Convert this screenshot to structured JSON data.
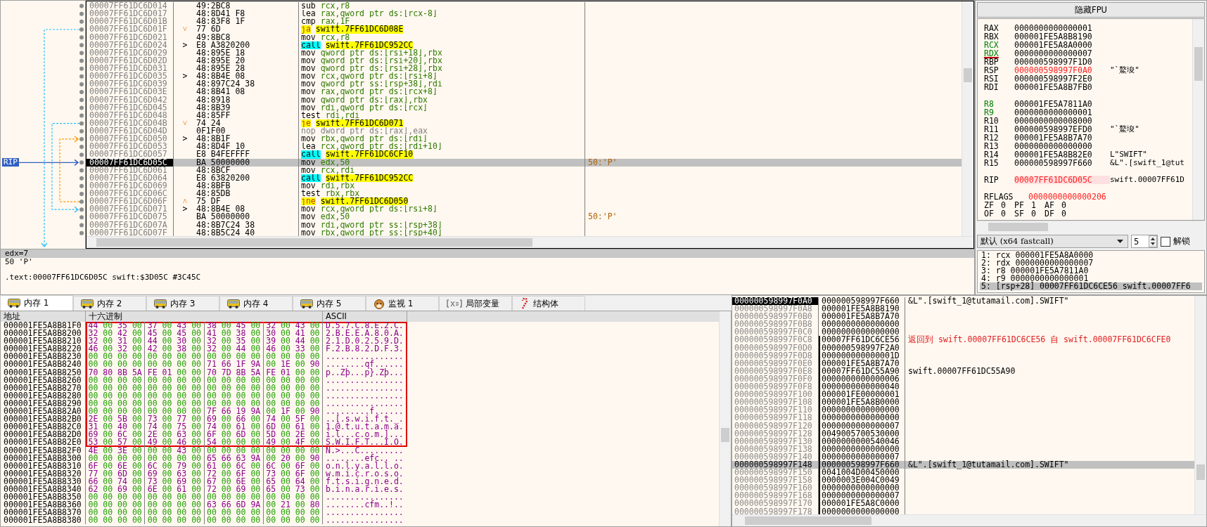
{
  "disassembly": {
    "rip_label": "RIP",
    "rows": [
      {
        "address": "00007FF61DC6D014",
        "bytes": "49:2BC8",
        "mnemonic": "sub",
        "operands": "rcx,r8",
        "kind": "plain",
        "selected": false
      },
      {
        "address": "00007FF61DC6D017",
        "bytes": "48:8D41 F8",
        "mnemonic": "lea",
        "operands": "rax,qword ptr ds:[rcx-8]",
        "kind": "plain",
        "selected": false
      },
      {
        "address": "00007FF61DC6D01B",
        "bytes": "48:83F8 1F",
        "mnemonic": "cmp",
        "operands": "rax,1F",
        "kind": "plain",
        "selected": false
      },
      {
        "address": "00007FF61DC6D01F",
        "marker": {
          "text": "˅",
          "kind": "jump"
        },
        "bytes": "77 6D",
        "mnemonic": "ja",
        "operands": "swift.7FF61DC6D08E",
        "kind": "jump",
        "selected": false
      },
      {
        "address": "00007FF61DC6D021",
        "bytes": "49:8BC8",
        "mnemonic": "mov",
        "operands": "rcx,r8",
        "kind": "plain",
        "selected": false
      },
      {
        "address": "00007FF61DC6D024",
        "marker": {
          "text": ">",
          "kind": "target"
        },
        "bytes": "E8 A3820200",
        "mnemonic": "call",
        "operands": "swift.7FF61DC952CC",
        "kind": "call",
        "selected": false
      },
      {
        "address": "00007FF61DC6D029",
        "bytes": "48:895E 18",
        "mnemonic": "mov",
        "operands": "qword ptr ds:[rsi+18],rbx",
        "kind": "plain",
        "selected": false
      },
      {
        "address": "00007FF61DC6D02D",
        "bytes": "48:895E 20",
        "mnemonic": "mov",
        "operands": "qword ptr ds:[rsi+20],rbx",
        "kind": "plain",
        "selected": false
      },
      {
        "address": "00007FF61DC6D031",
        "bytes": "48:895E 28",
        "mnemonic": "mov",
        "operands": "qword ptr ds:[rsi+28],rbx",
        "kind": "plain",
        "selected": false
      },
      {
        "address": "00007FF61DC6D035",
        "marker": {
          "text": ">",
          "kind": "target"
        },
        "bytes": "48:8B4E 08",
        "mnemonic": "mov",
        "operands": "rcx,qword ptr ds:[rsi+8]",
        "kind": "plain",
        "selected": false
      },
      {
        "address": "00007FF61DC6D039",
        "bytes": "48:897C24 38",
        "mnemonic": "mov",
        "operands": "qword ptr ss:[rsp+38],rdi",
        "kind": "plain",
        "selected": false
      },
      {
        "address": "00007FF61DC6D03E",
        "bytes": "48:8B41 08",
        "mnemonic": "mov",
        "operands": "rax,qword ptr ds:[rcx+8]",
        "kind": "plain",
        "selected": false
      },
      {
        "address": "00007FF61DC6D042",
        "bytes": "48:8918",
        "mnemonic": "mov",
        "operands": "qword ptr ds:[rax],rbx",
        "kind": "plain",
        "selected": false
      },
      {
        "address": "00007FF61DC6D045",
        "bytes": "48:8B39",
        "mnemonic": "mov",
        "operands": "rdi,qword ptr ds:[rcx]",
        "kind": "plain",
        "selected": false
      },
      {
        "address": "00007FF61DC6D048",
        "bytes": "48:85FF",
        "mnemonic": "test",
        "operands": "rdi,rdi",
        "kind": "plain",
        "selected": false
      },
      {
        "address": "00007FF61DC6D04B",
        "marker": {
          "text": "˅",
          "kind": "jump"
        },
        "bytes": "74 24",
        "mnemonic": "je",
        "operands": "swift.7FF61DC6D071",
        "kind": "jump",
        "selected": false
      },
      {
        "address": "00007FF61DC6D04D",
        "bytes": "0F1F00",
        "mnemonic": "nop",
        "operands": "dword ptr ds:[rax],eax",
        "kind": "nop",
        "selected": false
      },
      {
        "address": "00007FF61DC6D050",
        "marker": {
          "text": ">",
          "kind": "target"
        },
        "bytes": "48:8B1F",
        "mnemonic": "mov",
        "operands": "rbx,qword ptr ds:[rdi]",
        "kind": "plain",
        "selected": false
      },
      {
        "address": "00007FF61DC6D053",
        "bytes": "48:8D4F 10",
        "mnemonic": "lea",
        "operands": "rcx,qword ptr ds:[rdi+10]",
        "kind": "plain",
        "selected": false
      },
      {
        "address": "00007FF61DC6D057",
        "bytes": "E8 B4FEFFFF",
        "mnemonic": "call",
        "operands": "swift.7FF61DC6CF10",
        "kind": "call",
        "selected": false
      },
      {
        "address": "00007FF61DC6D05C",
        "bytes": "BA 50000000",
        "mnemonic": "mov",
        "operands": "edx,50",
        "kind": "plain",
        "comment": "50:'P'",
        "selected": true
      },
      {
        "address": "00007FF61DC6D061",
        "bytes": "48:8BCF",
        "mnemonic": "mov",
        "operands": "rcx,rdi",
        "kind": "plain",
        "selected": false
      },
      {
        "address": "00007FF61DC6D064",
        "bytes": "E8 63820200",
        "mnemonic": "call",
        "operands": "swift.7FF61DC952CC",
        "kind": "call",
        "selected": false
      },
      {
        "address": "00007FF61DC6D069",
        "bytes": "48:8BFB",
        "mnemonic": "mov",
        "operands": "rdi,rbx",
        "kind": "plain",
        "selected": false
      },
      {
        "address": "00007FF61DC6D06C",
        "bytes": "48:85DB",
        "mnemonic": "test",
        "operands": "rbx,rbx",
        "kind": "plain",
        "selected": false
      },
      {
        "address": "00007FF61DC6D06F",
        "marker": {
          "text": "˄",
          "kind": "jump"
        },
        "bytes": "75 DF",
        "mnemonic": "jne",
        "operands": "swift.7FF61DC6D050",
        "kind": "jump",
        "selected": false
      },
      {
        "address": "00007FF61DC6D071",
        "marker": {
          "text": ">",
          "kind": "target"
        },
        "bytes": "48:8B4E 08",
        "mnemonic": "mov",
        "operands": "rcx,qword ptr ds:[rsi+8]",
        "kind": "plain",
        "selected": false
      },
      {
        "address": "00007FF61DC6D075",
        "bytes": "BA 50000000",
        "mnemonic": "mov",
        "operands": "edx,50",
        "kind": "plain",
        "comment": "50:'P'",
        "selected": false
      },
      {
        "address": "00007FF61DC6D07A",
        "bytes": "48:8B7C24 38",
        "mnemonic": "mov",
        "operands": "rdi,qword ptr ss:[rsp+38]",
        "kind": "plain",
        "selected": false
      },
      {
        "address": "00007FF61DC6D07F",
        "bytes": "48:8B5C24 40",
        "mnemonic": "mov",
        "operands": "rbx,qword ptr ss:[rsp+40]",
        "kind": "plain",
        "selected": false
      }
    ]
  },
  "info": {
    "header": "edx=7",
    "lines": [
      "50 'P'"
    ],
    "location": ".text:00007FF61DC6D05C swift:$3D05C #3C45C"
  },
  "registers": {
    "toggle_button": "隐藏FPU",
    "groups": [
      [
        {
          "name": "RAX",
          "value": "0000000000000001",
          "modified": false,
          "value_changed": false
        },
        {
          "name": "RBX",
          "value": "000001FE5A8B8190",
          "modified": false,
          "value_changed": false
        },
        {
          "name": "RCX",
          "value": "000001FE5A8A0000",
          "modified": true,
          "value_changed": false
        },
        {
          "name": "RDX",
          "value": "0000000000000007",
          "modified": true,
          "value_changed": false,
          "focused": true
        },
        {
          "name": "RBP",
          "value": "000000598997F1D0",
          "modified": false,
          "value_changed": false
        },
        {
          "name": "RSP",
          "value": "000000598997F0A0",
          "comment": "\"`鰲埈\"",
          "modified": false,
          "value_changed": true
        },
        {
          "name": "RSI",
          "value": "000000598997F2E0",
          "modified": false,
          "value_changed": false
        },
        {
          "name": "RDI",
          "value": "000001FE5A8B7FB0",
          "modified": false,
          "value_changed": false
        }
      ],
      [
        {
          "name": "R8",
          "value": "000001FE5A7811A0",
          "modified": true,
          "value_changed": false
        },
        {
          "name": "R9",
          "value": "0000000000000001",
          "modified": true,
          "value_changed": false
        },
        {
          "name": "R10",
          "value": "0000000000008000",
          "modified": false,
          "value_changed": false
        },
        {
          "name": "R11",
          "value": "000000598997EFD0",
          "comment": "\"`鰲埈\"",
          "modified": false,
          "value_changed": false
        },
        {
          "name": "R12",
          "value": "000001FE5A8B7A70",
          "modified": false,
          "value_changed": false
        },
        {
          "name": "R13",
          "value": "0000000000000000",
          "modified": false,
          "value_changed": false
        },
        {
          "name": "R14",
          "value": "000001FE5A8B82E0",
          "comment": "L\"SWIFT\"",
          "modified": false,
          "value_changed": false
        },
        {
          "name": "R15",
          "value": "000000598997F660",
          "comment": "&L\".[swift_1@tut",
          "modified": false,
          "value_changed": false
        }
      ],
      [
        {
          "name": "RIP",
          "value": "00007FF61DC6D05C",
          "comment": "swift.00007FF61D",
          "modified": false,
          "value_changed": true,
          "highlighted": true
        }
      ]
    ],
    "rflags": {
      "name": "RFLAGS",
      "value": "0000000000000206",
      "value_changed": true
    },
    "flags": [
      [
        {
          "name": "ZF",
          "value": "0"
        },
        {
          "name": "PF",
          "value": "1"
        },
        {
          "name": "AF",
          "value": "0"
        }
      ],
      [
        {
          "name": "OF",
          "value": "0"
        },
        {
          "name": "SF",
          "value": "0"
        },
        {
          "name": "DF",
          "value": "0"
        }
      ]
    ]
  },
  "call_args": {
    "convention": "默认 (x64 fastcall)",
    "count": "5",
    "lock_label": "解锁",
    "locked": false,
    "items": [
      {
        "text": "1: rcx 000001FE5A8A0000",
        "selected": false
      },
      {
        "text": "2: rdx 0000000000000007",
        "selected": false
      },
      {
        "text": "3: r8 000001FE5A7811A0",
        "selected": false
      },
      {
        "text": "4: r9 0000000000000001",
        "selected": false
      },
      {
        "text": "5: [rsp+28] 00007FF61DC6CE56 swift.00007FF6",
        "selected": true
      }
    ]
  },
  "memory": {
    "tabs": [
      {
        "label": "内存 1",
        "kind": "bus",
        "selected": true
      },
      {
        "label": "内存 2",
        "kind": "bus",
        "selected": false
      },
      {
        "label": "内存 3",
        "kind": "bus",
        "selected": false
      },
      {
        "label": "内存 4",
        "kind": "bus",
        "selected": false
      },
      {
        "label": "内存 5",
        "kind": "bus",
        "selected": false
      },
      {
        "label": "监视 1",
        "kind": "dog",
        "selected": false
      },
      {
        "label": "局部变量",
        "kind": "variable",
        "selected": false
      },
      {
        "label": "结构体",
        "kind": "candy",
        "selected": false
      }
    ],
    "columns": [
      "地址",
      "十六进制",
      "ASCII"
    ],
    "rows": [
      {
        "address": "000001FE5A8B81F0",
        "hex": "44 00 35 00 37 00 43 00 38 00 45 00 32 00 43 00",
        "ascii": "D.5.7.C.8.E.2.C.",
        "boxed": true
      },
      {
        "address": "000001FE5A8B8200",
        "hex": "32 00 42 00 45 00 45 00 41 00 38 00 30 00 41 00",
        "ascii": "2.B.E.E.A.8.0.A.",
        "boxed": true
      },
      {
        "address": "000001FE5A8B8210",
        "hex": "32 00 31 00 44 00 30 00 32 00 35 00 39 00 44 00",
        "ascii": "2.1.D.0.2.5.9.D.",
        "boxed": true
      },
      {
        "address": "000001FE5A8B8220",
        "hex": "46 00 32 00 42 00 38 00 32 00 44 00 46 00 33 00",
        "ascii": "F.2.B.8.2.D.F.3.",
        "boxed": true
      },
      {
        "address": "000001FE5A8B8230",
        "hex": "00 00 00 00 00 00 00 00 00 00 00 00 00 00 00 00",
        "ascii": "................",
        "boxed": true
      },
      {
        "address": "000001FE5A8B8240",
        "hex": "00 00 00 00 00 00 00 00 71 66 1F 9A 00 1E 00 90",
        "ascii": "........qf......",
        "boxed": true
      },
      {
        "address": "000001FE5A8B8250",
        "hex": "70 80 8B 5A FE 01 00 00 70 7D 8B 5A FE 01 00 00",
        "ascii": "p..Zþ...p}.Zþ...",
        "boxed": true
      },
      {
        "address": "000001FE5A8B8260",
        "hex": "00 00 00 00 00 00 00 00 00 00 00 00 00 00 00 00",
        "ascii": "................",
        "boxed": true
      },
      {
        "address": "000001FE5A8B8270",
        "hex": "00 00 00 00 00 00 00 00 00 00 00 00 00 00 00 00",
        "ascii": "................",
        "boxed": true
      },
      {
        "address": "000001FE5A8B8280",
        "hex": "00 00 00 00 00 00 00 00 00 00 00 00 00 00 00 00",
        "ascii": "................",
        "boxed": true
      },
      {
        "address": "000001FE5A8B8290",
        "hex": "00 00 00 00 00 00 00 00 00 00 00 00 00 00 00 00",
        "ascii": "................",
        "boxed": true
      },
      {
        "address": "000001FE5A8B82A0",
        "hex": "00 00 00 00 00 00 00 00 7F 66 19 9A 00 1F 00 90",
        "ascii": ".........f......",
        "boxed": true
      },
      {
        "address": "000001FE5A8B82B0",
        "hex": "2E 00 5B 00 73 00 77 00 69 00 66 00 74 00 5F 00",
        "ascii": "..[.s.w.i.f.t._.",
        "boxed": true
      },
      {
        "address": "000001FE5A8B82C0",
        "hex": "31 00 40 00 74 00 75 00 74 00 61 00 6D 00 61 00",
        "ascii": "1.@.t.u.t.a.m.a.",
        "boxed": true
      },
      {
        "address": "000001FE5A8B82D0",
        "hex": "69 00 6C 00 2E 00 63 00 6F 00 6D 00 5D 00 2E 00",
        "ascii": "i.l...c.o.m.]...",
        "boxed": true
      },
      {
        "address": "000001FE5A8B82E0",
        "hex": "53 00 57 00 49 00 46 00 54 00 00 00 49 00 4F 00",
        "ascii": "S.W.I.F.T...I.O.",
        "boxed": true
      },
      {
        "address": "000001FE5A8B82F0",
        "hex": "4E 00 3E 00 00 00 43 00 00 00 00 00 00 00 00 00",
        "ascii": "N.>...C.........",
        "boxed": false
      },
      {
        "address": "000001FE5A8B8300",
        "hex": "00 00 00 00 00 00 00 00 65 66 63 9A 00 20 00 90",
        "ascii": "........efc.. ..",
        "boxed": false
      },
      {
        "address": "000001FE5A8B8310",
        "hex": "6F 00 6E 00 6C 00 79 00 61 00 6C 00 6C 00 6F 00",
        "ascii": "o.n.l.y.a.l.l.o.",
        "boxed": false
      },
      {
        "address": "000001FE5A8B8320",
        "hex": "77 00 6D 00 69 00 63 00 72 00 6F 00 73 00 6F 00",
        "ascii": "w.m.i.c.r.o.s.o.",
        "boxed": false
      },
      {
        "address": "000001FE5A8B8330",
        "hex": "66 00 74 00 73 00 69 00 67 00 6E 00 65 00 64 00",
        "ascii": "f.t.s.i.g.n.e.d.",
        "boxed": false
      },
      {
        "address": "000001FE5A8B8340",
        "hex": "62 00 69 00 6E 00 61 00 72 00 69 00 65 00 73 00",
        "ascii": "b.i.n.a.r.i.e.s.",
        "boxed": false
      },
      {
        "address": "000001FE5A8B8350",
        "hex": "00 00 00 00 00 00 00 00 00 00 00 00 00 00 00 00",
        "ascii": "................",
        "boxed": false
      },
      {
        "address": "000001FE5A8B8360",
        "hex": "00 00 00 00 00 00 00 00 63 66 6D 9A 00 21 00 80",
        "ascii": "........cfm..!..",
        "boxed": false
      },
      {
        "address": "000001FE5A8B8370",
        "hex": "00 00 00 00 00 00 00 00 00 00 00 00 00 00 00 00",
        "ascii": "................",
        "boxed": false
      },
      {
        "address": "000001FE5A8B8380",
        "hex": "00 00 00 00 00 00 00 00 00 00 00 00 00 00 00 00",
        "ascii": "................",
        "boxed": false
      }
    ]
  },
  "stack": {
    "rows": [
      {
        "address": "000000598997F0A0",
        "value": "000000598997F660",
        "comment": {
          "text": "&L\".[swift_1@tutamail.com].SWIFT\"",
          "kind": "plain"
        },
        "current": true,
        "selected": false,
        "in_frame": false
      },
      {
        "address": "000000598997F0A8",
        "value": "000001FE5A8B8190",
        "current": false,
        "selected": false,
        "in_frame": false
      },
      {
        "address": "000000598997F0B0",
        "value": "000001FE5A8B7A70",
        "current": false,
        "selected": false,
        "in_frame": false
      },
      {
        "address": "000000598997F0B8",
        "value": "0000000000000000",
        "current": false,
        "selected": false,
        "in_frame": false
      },
      {
        "address": "000000598997F0C0",
        "value": "0000000000000000",
        "current": false,
        "selected": false,
        "in_frame": false
      },
      {
        "address": "000000598997F0C8",
        "value": "00007FF61DC6CE56",
        "comment": {
          "text": "返回到 swift.00007FF61DC6CE56 自 swift.00007FF61DC6CFE0",
          "kind": "return"
        },
        "current": false,
        "selected": false,
        "in_frame": true
      },
      {
        "address": "000000598997F0D0",
        "value": "000000598997F2A0",
        "current": false,
        "selected": false,
        "in_frame": true
      },
      {
        "address": "000000598997F0D8",
        "value": "000000000000001D",
        "current": false,
        "selected": false,
        "in_frame": true
      },
      {
        "address": "000000598997F0E0",
        "value": "000001FE5A8B7A70",
        "current": false,
        "selected": false,
        "in_frame": true
      },
      {
        "address": "000000598997F0E8",
        "value": "00007FF61DC55A90",
        "comment": {
          "text": "swift.00007FF61DC55A90",
          "kind": "plain"
        },
        "current": false,
        "selected": false,
        "in_frame": true
      },
      {
        "address": "000000598997F0F0",
        "value": "0000000000000006",
        "current": false,
        "selected": false,
        "in_frame": true
      },
      {
        "address": "000000598997F0F8",
        "value": "0000000000000040",
        "current": false,
        "selected": false,
        "in_frame": true
      },
      {
        "address": "000000598997F100",
        "value": "000001FE00000001",
        "current": false,
        "selected": false,
        "in_frame": true
      },
      {
        "address": "000000598997F108",
        "value": "000001FE5A8B0000",
        "current": false,
        "selected": false,
        "in_frame": true
      },
      {
        "address": "000000598997F110",
        "value": "0000000000000000",
        "current": false,
        "selected": false,
        "in_frame": true
      },
      {
        "address": "000000598997F118",
        "value": "0000000000000000",
        "current": false,
        "selected": false,
        "in_frame": true
      },
      {
        "address": "000000598997F120",
        "value": "0000000000000007",
        "current": false,
        "selected": false,
        "in_frame": true
      },
      {
        "address": "000000598997F128",
        "value": "0049005700530000",
        "current": false,
        "selected": false,
        "in_frame": true
      },
      {
        "address": "000000598997F130",
        "value": "0000000000540046",
        "current": false,
        "selected": false,
        "in_frame": true
      },
      {
        "address": "000000598997F138",
        "value": "0000000000000000",
        "current": false,
        "selected": false,
        "in_frame": true
      },
      {
        "address": "000000598997F140",
        "value": "0000000000000007",
        "current": false,
        "selected": false,
        "in_frame": true
      },
      {
        "address": "000000598997F148",
        "value": "000000598997F660",
        "comment": {
          "text": "&L\".[swift_1@tutamail.com].SWIFT\"",
          "kind": "plain"
        },
        "current": false,
        "selected": true,
        "in_frame": true
      },
      {
        "address": "000000598997F150",
        "value": "0041004D00450000",
        "current": false,
        "selected": false,
        "in_frame": true
      },
      {
        "address": "000000598997F158",
        "value": "0000003E004C0049",
        "current": false,
        "selected": false,
        "in_frame": true
      },
      {
        "address": "000000598997F160",
        "value": "0000000000000000",
        "current": false,
        "selected": false,
        "in_frame": true
      },
      {
        "address": "000000598997F168",
        "value": "0000000000000007",
        "current": false,
        "selected": false,
        "in_frame": true
      },
      {
        "address": "000000598997F170",
        "value": "000001FE5A8C0000",
        "current": false,
        "selected": false,
        "in_frame": true
      },
      {
        "address": "000000598997F178",
        "value": "0000000000000000",
        "current": false,
        "selected": false,
        "in_frame": true
      }
    ]
  }
}
